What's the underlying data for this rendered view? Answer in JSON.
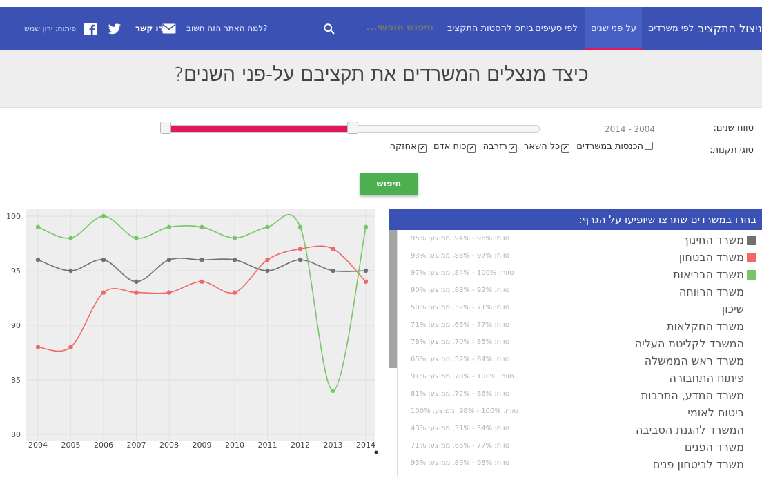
{
  "nav": {
    "brand": "ניצול התקציב",
    "items": [
      {
        "label": "לפי משרדים"
      },
      {
        "label": "על פני שנים"
      },
      {
        "label": "לפי סעיפים"
      },
      {
        "label": "ביחס להסטות התקציב"
      }
    ],
    "search_label": "חיפוש חופשי...",
    "why_label": "למה האתר הזה חשוב?",
    "contact_label": "צרו קשר",
    "dev_label": "פיתוח: ירון שמש",
    "icons": {
      "search": "search-icon",
      "mail": "mail-icon",
      "twitter": "twitter-icon",
      "facebook": "facebook-icon"
    }
  },
  "hero": {
    "title": "כיצד מנצלים המשרדים את תקציבם על-פני השנים?"
  },
  "filters": {
    "years_label": "טווח שנים:",
    "years_value": "2014 - 2004",
    "years_range": {
      "min": 2004,
      "max": 2014,
      "from": 2004,
      "to": 2009
    },
    "types_label": "סוגי תקנות:",
    "types": [
      {
        "label": "הכנסות במשרדים",
        "checked": false
      },
      {
        "label": "כל השאר",
        "checked": true
      },
      {
        "label": "רזרבה",
        "checked": true
      },
      {
        "label": "כוח אדם",
        "checked": true
      },
      {
        "label": "אחזקה",
        "checked": true
      }
    ],
    "search_button": "חיפוש"
  },
  "panel": {
    "title": "בחרו במשרדים שתרצו שיופיעו על הגרף:",
    "ministries": [
      {
        "name": "משרד החינוך",
        "range": "טווח: 96% - 94%, ממוצע: 95%",
        "color": "#707070",
        "selected": true
      },
      {
        "name": "משרד הבטחון",
        "range": "טווח: 97% - 88%, ממוצע: 93%",
        "color": "#f06969",
        "selected": true
      },
      {
        "name": "משרד הבריאות",
        "range": "טווח: 100% - 84%, ממוצע: 97%",
        "color": "#75c765",
        "selected": true
      },
      {
        "name": "משרד הרווחה",
        "range": "טווח: 92% - 88%, ממוצע: 90%",
        "color": "",
        "selected": false
      },
      {
        "name": "שיכון",
        "range": "טווח: 71% - 32%, ממוצע: 50%",
        "color": "",
        "selected": false
      },
      {
        "name": "משרד החקלאות",
        "range": "טווח: 77% - 66%, ממוצע: 71%",
        "color": "",
        "selected": false
      },
      {
        "name": "המשרד לקליטת העליה",
        "range": "טווח: 85% - 70%, ממוצע: 78%",
        "color": "",
        "selected": false
      },
      {
        "name": "משרד ראש הממשלה",
        "range": "טווח: 84% - 52%, ממוצע: 65%",
        "color": "",
        "selected": false
      },
      {
        "name": "פיתוח התחבורה",
        "range": "טווח: 100% - 78%, ממוצע: 91%",
        "color": "",
        "selected": false
      },
      {
        "name": "משרד המדע, התרבות",
        "range": "טווח: 86% - 72%, ממוצע: 81%",
        "color": "",
        "selected": false
      },
      {
        "name": "ביטוח לאומי",
        "range": "טווח: 100% - 98%, ממוצע: 100%",
        "color": "",
        "selected": false
      },
      {
        "name": "המשרד להגנת הסביבה",
        "range": "טווח: 54% - 31%, ממוצע: 43%",
        "color": "",
        "selected": false
      },
      {
        "name": "משרד הפנים",
        "range": "טווח: 77% - 66%, ממוצע: 71%",
        "color": "",
        "selected": false
      },
      {
        "name": "משרד לביטחון פנים",
        "range": "טווח: 98% - 89%, ממוצע: 93%",
        "color": "",
        "selected": false
      }
    ]
  },
  "chart_data": {
    "type": "line",
    "x": [
      2004,
      2005,
      2006,
      2007,
      2008,
      2009,
      2010,
      2011,
      2012,
      2013,
      2014
    ],
    "ylim": [
      80,
      100
    ],
    "yticks": [
      80,
      85,
      90,
      95,
      100
    ],
    "grid": true,
    "series": [
      {
        "name": "משרד החינוך",
        "color": "#707070",
        "values": [
          96,
          95,
          96,
          94,
          96,
          96,
          96,
          95,
          96,
          95,
          95
        ]
      },
      {
        "name": "משרד הבטחון",
        "color": "#f06969",
        "values": [
          88,
          88,
          93,
          93,
          93,
          94,
          93,
          96,
          97,
          97,
          94
        ]
      },
      {
        "name": "משרד הבריאות",
        "color": "#75c765",
        "values": [
          99,
          98,
          100,
          98,
          99,
          99,
          98,
          99,
          99,
          84,
          99
        ]
      }
    ]
  }
}
